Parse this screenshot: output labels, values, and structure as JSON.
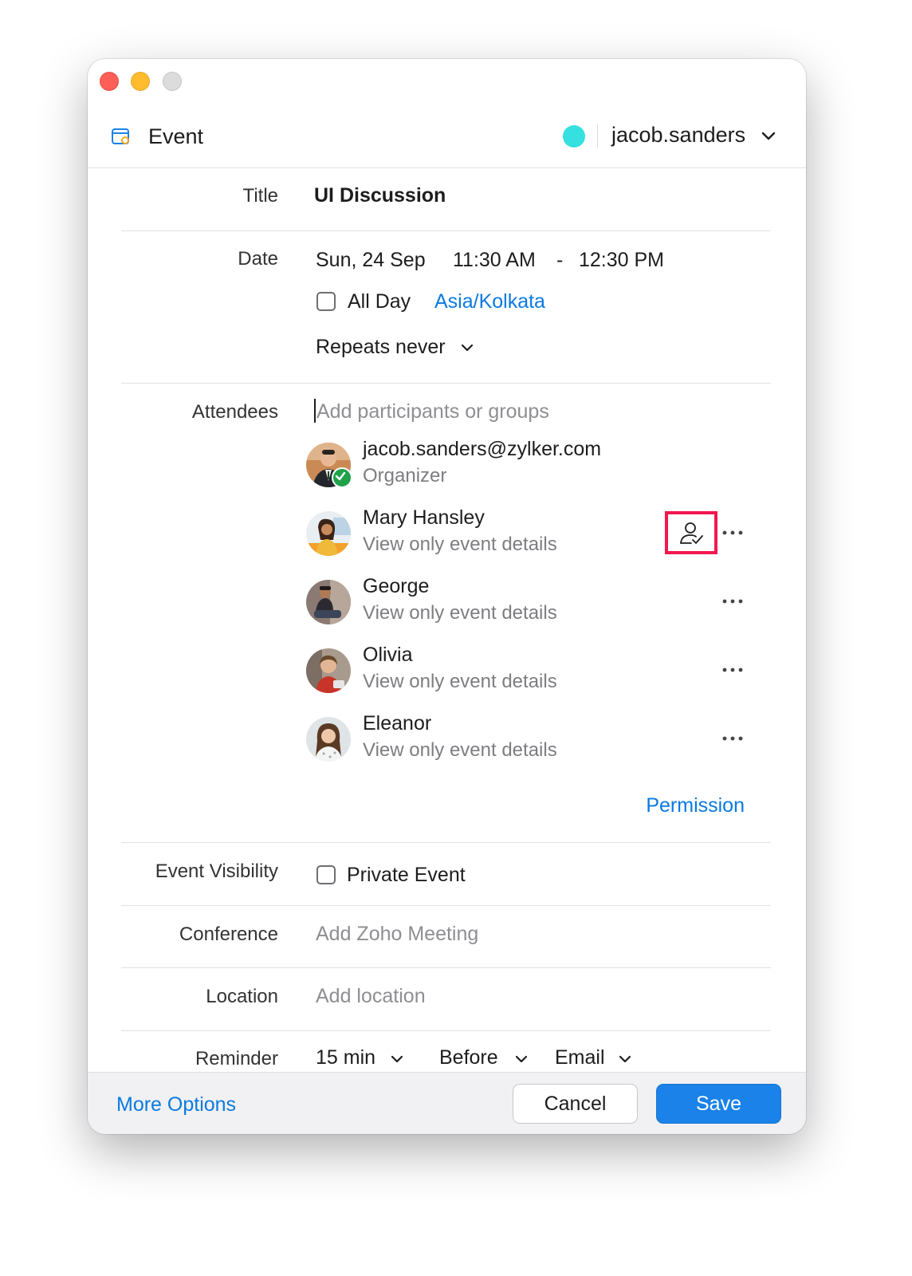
{
  "header": {
    "title": "Event",
    "account": "jacob.sanders",
    "account_color": "#34e0e0"
  },
  "form": {
    "title": {
      "label": "Title",
      "value": "UI Discussion"
    },
    "date": {
      "label": "Date",
      "day": "Sun, 24 Sep",
      "start": "11:30 AM",
      "separator": "-",
      "end": "12:30 PM",
      "all_day_label": "All Day",
      "all_day_checked": false,
      "timezone": "Asia/Kolkata",
      "repeats": "Repeats never"
    },
    "attendees": {
      "label": "Attendees",
      "placeholder": "Add participants or groups",
      "list": [
        {
          "name": "jacob.sanders@zylker.com",
          "role": "Organizer"
        },
        {
          "name": "Mary Hansley",
          "role": "View only event details"
        },
        {
          "name": "George",
          "role": "View only event details"
        },
        {
          "name": "Olivia",
          "role": "View only event details"
        },
        {
          "name": "Eleanor",
          "role": "View only event details"
        }
      ],
      "permission_link": "Permission"
    },
    "visibility": {
      "label": "Event Visibility",
      "option": "Private Event",
      "checked": false
    },
    "conference": {
      "label": "Conference",
      "placeholder": "Add Zoho Meeting"
    },
    "location": {
      "label": "Location",
      "placeholder": "Add location"
    },
    "reminder": {
      "label": "Reminder",
      "time": "15 min",
      "relation": "Before",
      "method": "Email"
    }
  },
  "footer": {
    "more_options": "More Options",
    "cancel": "Cancel",
    "save": "Save"
  },
  "colors": {
    "accent": "#0a7ae0",
    "save_button": "#1a82e8",
    "highlight": "#f2184f",
    "organizer_badge": "#1fa24a"
  },
  "icons": [
    "calendar-icon",
    "chevron-down-icon",
    "checkmark-icon",
    "user-check-icon",
    "more-icon"
  ]
}
